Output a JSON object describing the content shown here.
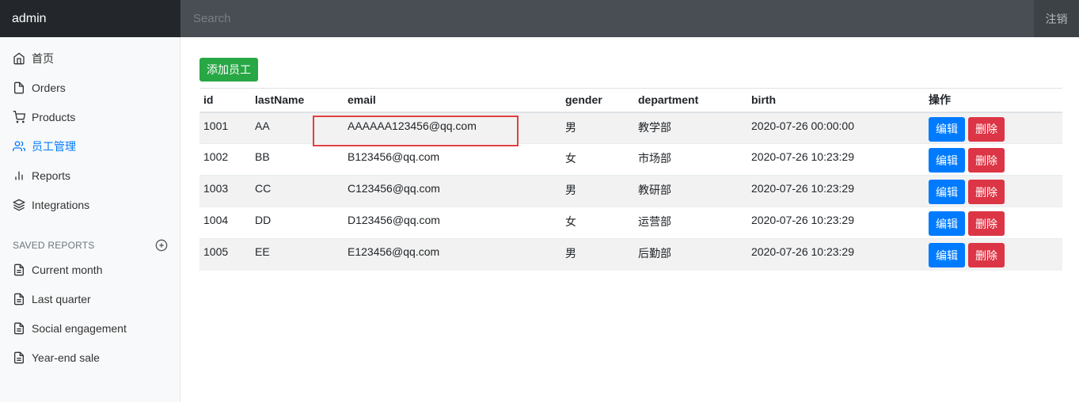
{
  "navbar": {
    "brand": "admin",
    "search_placeholder": "Search",
    "signout": "注销"
  },
  "sidebar": {
    "items": [
      {
        "label": "首页",
        "icon": "home-icon"
      },
      {
        "label": "Orders",
        "icon": "file-icon"
      },
      {
        "label": "Products",
        "icon": "cart-icon"
      },
      {
        "label": "员工管理",
        "icon": "users-icon",
        "active": true
      },
      {
        "label": "Reports",
        "icon": "bar-chart-icon"
      },
      {
        "label": "Integrations",
        "icon": "layers-icon"
      }
    ],
    "saved_reports_title": "SAVED REPORTS",
    "saved_reports": [
      {
        "label": "Current month"
      },
      {
        "label": "Last quarter"
      },
      {
        "label": "Social engagement"
      },
      {
        "label": "Year-end sale"
      }
    ]
  },
  "main": {
    "add_button": "添加员工",
    "columns": [
      "id",
      "lastName",
      "email",
      "gender",
      "department",
      "birth",
      "操作"
    ],
    "rows": [
      [
        "1001",
        "AA",
        "AAAAAA123456@qq.com",
        "男",
        "教学部",
        "2020-07-26 00:00:00"
      ],
      [
        "1002",
        "BB",
        "B123456@qq.com",
        "女",
        "市场部",
        "2020-07-26 10:23:29"
      ],
      [
        "1003",
        "CC",
        "C123456@qq.com",
        "男",
        "教研部",
        "2020-07-26 10:23:29"
      ],
      [
        "1004",
        "DD",
        "D123456@qq.com",
        "女",
        "运营部",
        "2020-07-26 10:23:29"
      ],
      [
        "1005",
        "EE",
        "E123456@qq.com",
        "男",
        "后勤部",
        "2020-07-26 10:23:29"
      ]
    ],
    "edit_label": "编辑",
    "delete_label": "删除"
  },
  "colors": {
    "primary": "#007bff",
    "success": "#28a745",
    "danger": "#dc3545",
    "navbar": "#343a40",
    "highlight": "#e04040"
  }
}
